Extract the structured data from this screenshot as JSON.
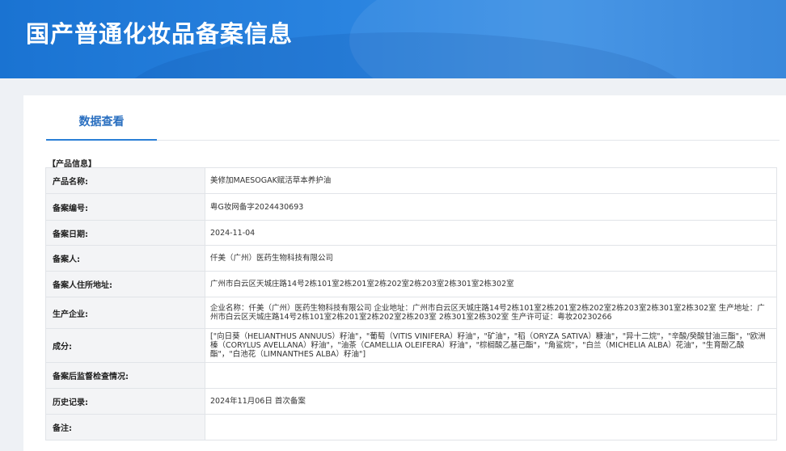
{
  "header": {
    "title": "国产普通化妆品备案信息"
  },
  "tabs": [
    {
      "label": "数据查看"
    }
  ],
  "section": {
    "title": "【产品信息】"
  },
  "rows": [
    {
      "label": "产品名称:",
      "value": "美修加MAESOGAK赋活草本养护油"
    },
    {
      "label": "备案编号:",
      "value": "粤G妆网备字2024430693"
    },
    {
      "label": "备案日期:",
      "value": "2024-11-04"
    },
    {
      "label": "备案人:",
      "value": "仟美（广州）医药生物科技有限公司"
    },
    {
      "label": "备案人住所地址:",
      "value": "广州市白云区天城庄路14号2栋101室2栋201室2栋202室2栋203室2栋301室2栋302室"
    },
    {
      "label": "生产企业:",
      "value": "企业名称：仟美（广州）医药生物科技有限公司 企业地址：广州市白云区天城庄路14号2栋101室2栋201室2栋202室2栋203室2栋301室2栋302室 生产地址：广州市白云区天城庄路14号2栋101室2栋201室2栋202室2栋203室 2栋301室2栋302室 生产许可证：粤妆20230266"
    },
    {
      "label": "成分:",
      "value": "[\"向日葵（HELIANTHUS ANNUUS）籽油\"，\"葡萄（VITIS VINIFERA）籽油\"，\"矿油\"，\"稻（ORYZA SATIVA）糠油\"，\"异十二烷\"，\"辛酸/癸酸甘油三酯\"，\"欧洲榛（CORYLUS AVELLANA）籽油\"，\"油茶（CAMELLIA OLEIFERA）籽油\"，\"棕榈酸乙基己酯\"，\"角鲨烷\"，\"白兰（MICHELIA ALBA）花油\"，\"生育酚乙酸酯\"，\"白池花（LIMNANTHES ALBA）籽油\"]"
    },
    {
      "label": "备案后监督检查情况:",
      "value": ""
    },
    {
      "label": "历史记录:",
      "value": "2024年11月06日 首次备案"
    },
    {
      "label": "备注:",
      "value": ""
    }
  ]
}
